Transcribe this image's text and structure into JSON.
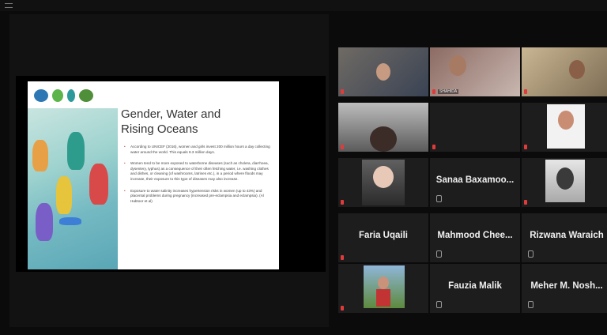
{
  "slide": {
    "title_line1": "Gender, Water and",
    "title_line2": "Rising Oceans",
    "bullet1": "According to UNICEF (2016), women and girls invest 200 million hours a day collecting water around the world. This equals 8.3 million days.",
    "bullet2": "Women tend to be more exposed to waterborne diseases (such as cholera, diarrhoea, dysentery, typhus) as a consequence of their often fetching water, i.e. washing clothes and dishes, or cleaning (of washrooms, latrines etc.), in a period where floods may increase, their exposure to this type of diseases may also increase.",
    "bullet3": "Exposure to water salinity increases hypertension risks in women (up to 43%) and placental problems during pregnancy (increased pre-eclampsia and eclampsia). (Al Habtoor et al)"
  },
  "participants": [
    {
      "name": "",
      "video": true
    },
    {
      "name": "SHAHIDA",
      "video": true
    },
    {
      "name": "",
      "video": true
    },
    {
      "name": "",
      "video": true
    },
    {
      "name": "",
      "video": true
    },
    {
      "name": "",
      "video": true
    },
    {
      "name": "",
      "video": true
    },
    {
      "name": "Sanaa Baxamoo...",
      "video": false
    },
    {
      "name": "",
      "video": true
    },
    {
      "name": "Faria Uqaili",
      "video": false
    },
    {
      "name": "Mahmood  Chee...",
      "video": false
    },
    {
      "name": "Rizwana Waraich",
      "video": false
    },
    {
      "name": "",
      "video": true
    },
    {
      "name": "Fauzia Malik",
      "video": false
    },
    {
      "name": "Meher  M. Nosh...",
      "video": false
    }
  ],
  "colors": {
    "active_speaker": "#d7d62a",
    "mic_muted": "#e03b3b",
    "background": "#0b0b0b"
  }
}
